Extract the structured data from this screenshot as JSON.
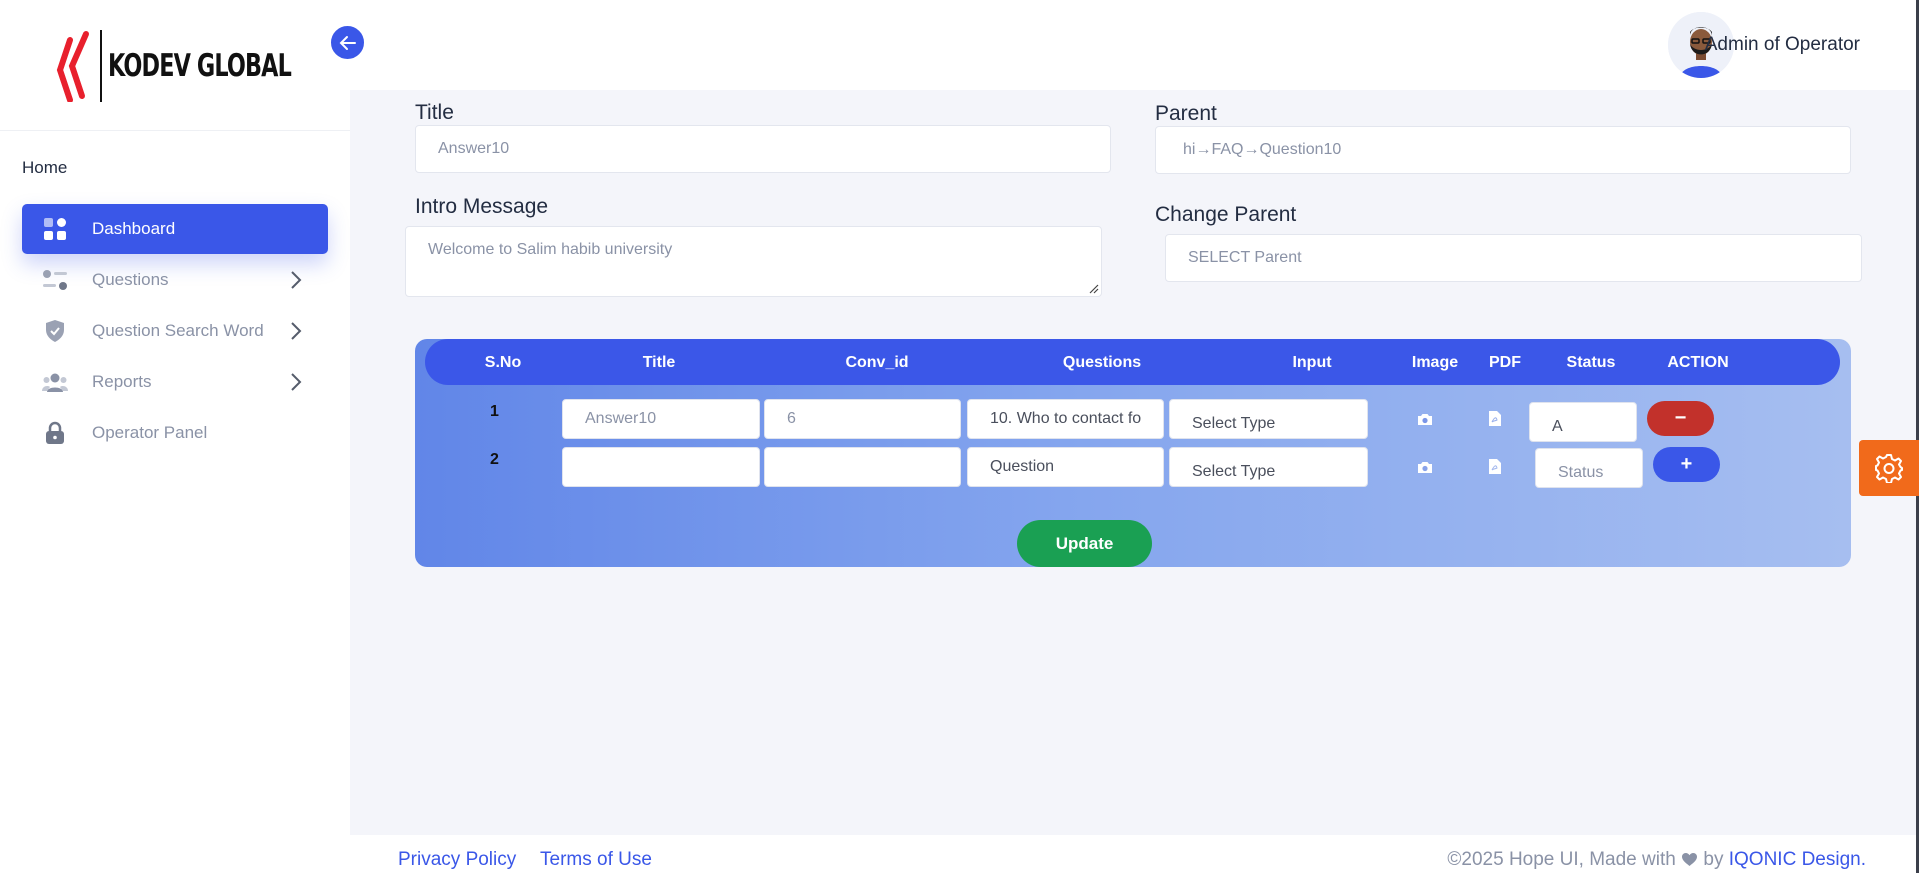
{
  "brand": {
    "logo_text": "KODEV GLOBAL"
  },
  "sidebar": {
    "section_title": "Home",
    "items": [
      {
        "label": "Dashboard",
        "icon": "dashboard-grid-icon",
        "active": true
      },
      {
        "label": "Questions",
        "icon": "sliders-icon",
        "has_submenu": true
      },
      {
        "label": "Question Search Word",
        "icon": "shield-check-icon",
        "has_submenu": true
      },
      {
        "label": "Reports",
        "icon": "users-group-icon",
        "has_submenu": true
      },
      {
        "label": "Operator Panel",
        "icon": "lock-icon"
      }
    ]
  },
  "header": {
    "user_name": "Admin of Operator"
  },
  "form": {
    "title_label": "Title",
    "title_value": "Answer10",
    "parent_label": "Parent",
    "parent_value": "hi→FAQ→Question10",
    "intro_label": "Intro Message",
    "intro_value": "Welcome to Salim habib university",
    "change_parent_label": "Change Parent",
    "change_parent_value": "SELECT Parent"
  },
  "table": {
    "headers": [
      "S.No",
      "Title",
      "Conv_id",
      "Questions",
      "Input",
      "Image",
      "PDF",
      "Status",
      "ACTION"
    ],
    "rows": [
      {
        "sno": "1",
        "title": "Answer10",
        "conv_id": "6",
        "question": "10. Who to contact fo",
        "input": "Select Type",
        "status": "A",
        "action": "−"
      },
      {
        "sno": "2",
        "title": "",
        "conv_id": "",
        "question": "Question",
        "input": "Select Type",
        "status": "Status",
        "action": "+"
      }
    ],
    "update_label": "Update"
  },
  "footer": {
    "privacy": "Privacy Policy",
    "terms": "Terms of Use",
    "copyright_prefix": "©2025 Hope UI, Made with",
    "by": "by",
    "credit": "IQONIC Design."
  },
  "colors": {
    "primary": "#3a57e8",
    "success": "#1aa053",
    "danger": "#c2312b",
    "warning": "#f16a1b"
  }
}
